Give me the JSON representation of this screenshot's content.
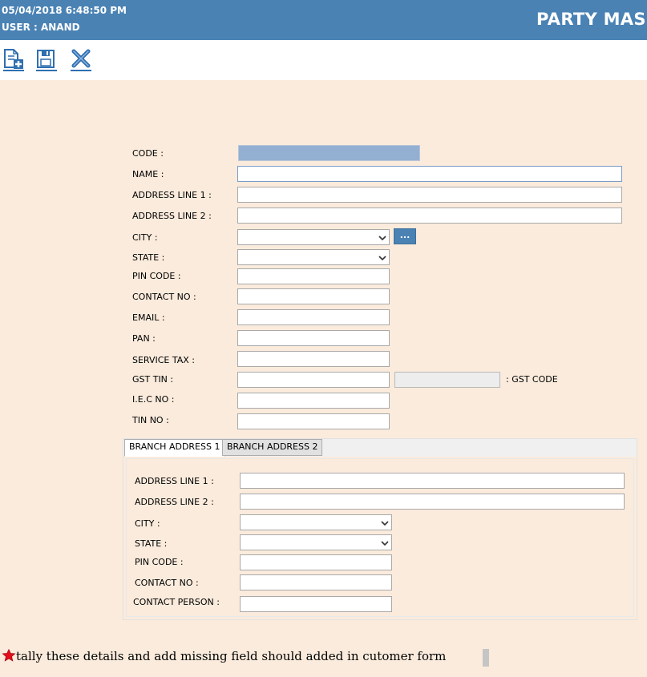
{
  "header": {
    "datetime": "05/04/2018 6:48:50 PM",
    "user": "USER :  ANAND",
    "title": "PARTY MAS"
  },
  "toolbar": {
    "buttons": [
      {
        "name": "new-document-icon"
      },
      {
        "name": "save-icon"
      },
      {
        "name": "close-icon"
      }
    ]
  },
  "form": {
    "code_label": "CODE :",
    "code_value": "",
    "name_label": "NAME :",
    "name_value": "",
    "address1_label": "ADDRESS LINE 1 :",
    "address1_value": "",
    "address2_label": "ADDRESS LINE 2 :",
    "address2_value": "",
    "city_label": "CITY :",
    "city_value": "",
    "city_button": "...",
    "state_label": "STATE :",
    "state_value": "",
    "pin_label": "PIN CODE :",
    "pin_value": "",
    "contact_label": "CONTACT NO :",
    "contact_value": "",
    "email_label": "EMAIL :",
    "email_value": "",
    "pan_label": "PAN :",
    "pan_value": "",
    "service_tax_label": "SERVICE TAX :",
    "service_tax_value": "",
    "gst_tin_label": "GST TIN :",
    "gst_tin_value": "",
    "gst_code_label": ": GST CODE",
    "gst_code_value": "",
    "iec_label": "I.E.C NO :",
    "iec_value": "",
    "tin_label": "TIN NO :",
    "tin_value": ""
  },
  "tabs": {
    "items": [
      {
        "label": "BRANCH ADDRESS 1",
        "active": true
      },
      {
        "label": "BRANCH ADDRESS 2",
        "active": false
      }
    ]
  },
  "branch": {
    "address1_label": "ADDRESS LINE 1 :",
    "address1_value": "",
    "address2_label": "ADDRESS LINE 2 :",
    "address2_value": "",
    "city_label": "CITY :",
    "city_value": "",
    "state_label": "STATE :",
    "state_value": "",
    "pin_label": "PIN CODE :",
    "pin_value": "",
    "contact_label": "CONTACT NO :",
    "contact_value": "",
    "contact_person_label": "CONTACT PERSON :",
    "contact_person_value": ""
  },
  "note": {
    "text": "tally these details and add missing field should added in cutomer form",
    "icon": "red-star-icon"
  },
  "colors": {
    "header_bg": "#4A82B4",
    "page_bg": "#FAEBDC",
    "code_field_bg": "#93AFD2",
    "accent_red": "#E0101A"
  }
}
